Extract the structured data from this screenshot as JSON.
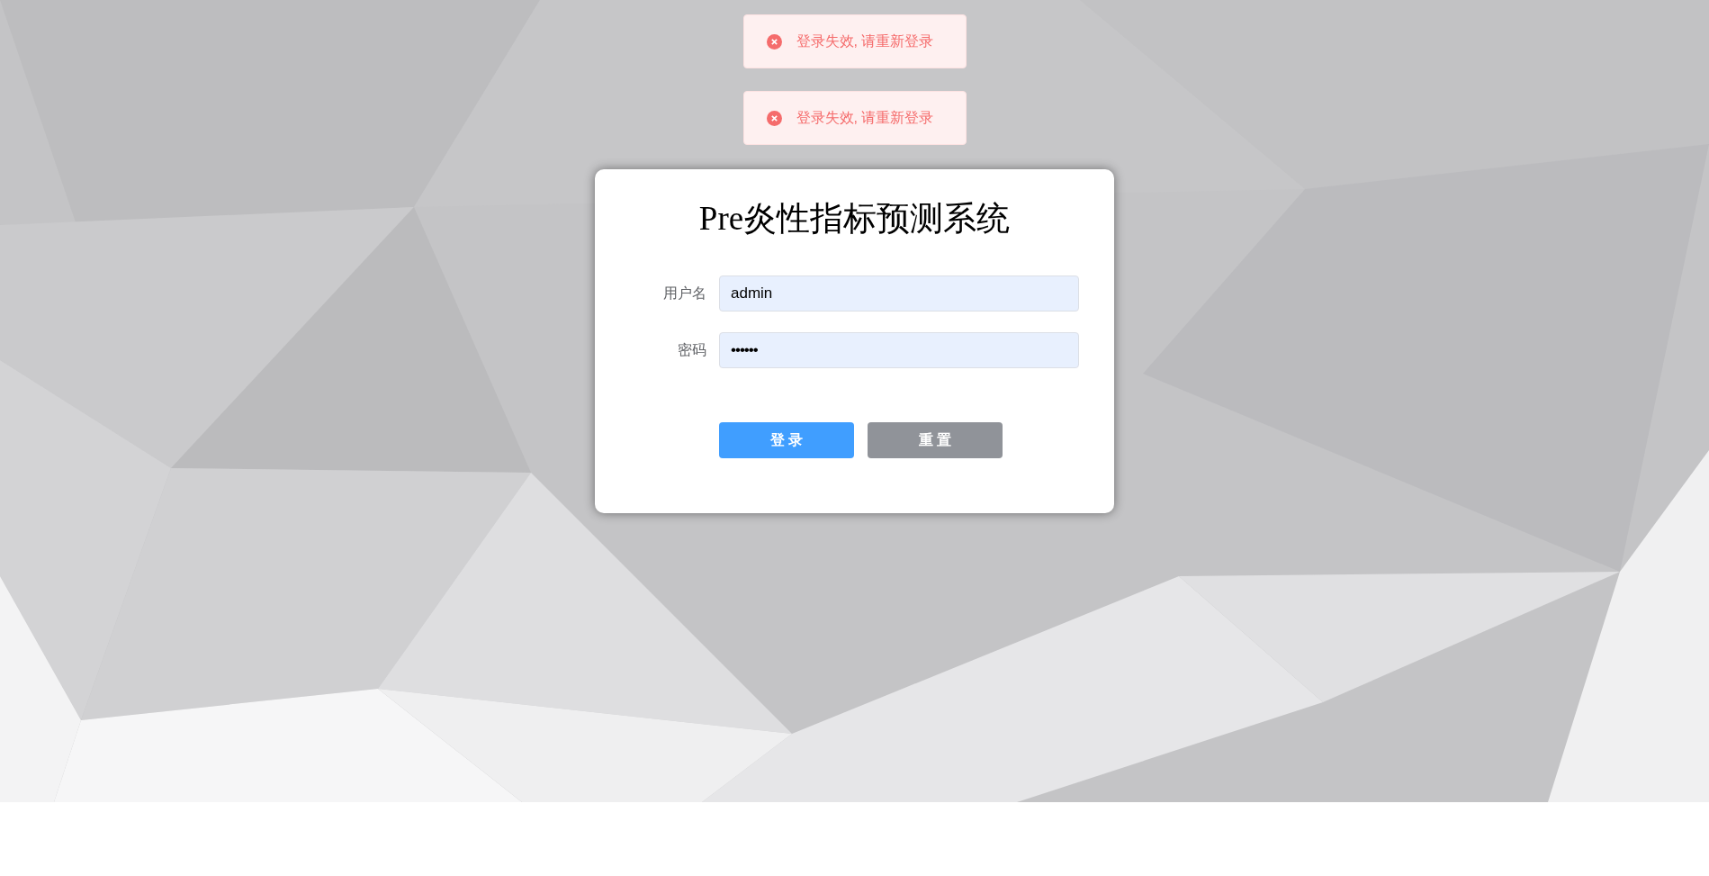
{
  "notifications": [
    {
      "kind": "error",
      "message": "登录失效, 请重新登录"
    },
    {
      "kind": "error",
      "message": "登录失效, 请重新登录"
    }
  ],
  "login": {
    "title": "Pre炎性指标预测系统",
    "fields": [
      {
        "label": "用户名",
        "value": "admin",
        "kind": "text"
      },
      {
        "label": "密码",
        "value": "••••••",
        "kind": "password"
      }
    ],
    "buttons": [
      {
        "label": "登 录",
        "kind": "primary"
      },
      {
        "label": "重 置",
        "kind": "secondary"
      }
    ]
  }
}
